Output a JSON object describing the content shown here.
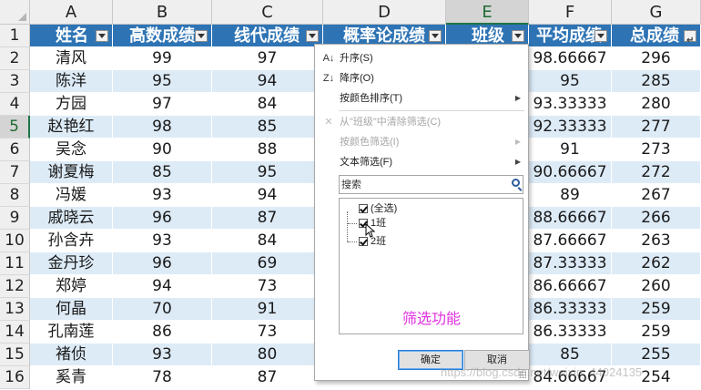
{
  "columns": [
    "A",
    "B",
    "C",
    "D",
    "E",
    "F",
    "G"
  ],
  "selected_column": "E",
  "selected_row": "5",
  "header_row_number": "1",
  "headers": [
    "姓名",
    "高数成绩",
    "线代成绩",
    "概率论成绩",
    "班级",
    "平均成绩",
    "总成绩"
  ],
  "rows": [
    {
      "num": "2",
      "name": "清风",
      "math": "99",
      "linear": "97",
      "avg": "98.66667",
      "total": "296"
    },
    {
      "num": "3",
      "name": "陈洋",
      "math": "95",
      "linear": "94",
      "avg": "95",
      "total": "285"
    },
    {
      "num": "4",
      "name": "方园",
      "math": "97",
      "linear": "84",
      "avg": "93.33333",
      "total": "280"
    },
    {
      "num": "5",
      "name": "赵艳红",
      "math": "98",
      "linear": "85",
      "avg": "92.33333",
      "total": "277"
    },
    {
      "num": "6",
      "name": "吴念",
      "math": "90",
      "linear": "88",
      "avg": "91",
      "total": "273"
    },
    {
      "num": "7",
      "name": "谢夏梅",
      "math": "85",
      "linear": "95",
      "avg": "90.66667",
      "total": "272"
    },
    {
      "num": "8",
      "name": "冯媛",
      "math": "93",
      "linear": "94",
      "avg": "89",
      "total": "267"
    },
    {
      "num": "9",
      "name": "戚晓云",
      "math": "96",
      "linear": "87",
      "avg": "88.66667",
      "total": "266"
    },
    {
      "num": "10",
      "name": "孙含卉",
      "math": "93",
      "linear": "84",
      "avg": "87.66667",
      "total": "263"
    },
    {
      "num": "11",
      "name": "金丹珍",
      "math": "96",
      "linear": "69",
      "avg": "87.33333",
      "total": "262"
    },
    {
      "num": "12",
      "name": "郑婷",
      "math": "94",
      "linear": "73",
      "avg": "86.66667",
      "total": "260"
    },
    {
      "num": "13",
      "name": "何晶",
      "math": "70",
      "linear": "91",
      "avg": "86.33333",
      "total": "259"
    },
    {
      "num": "14",
      "name": "孔南莲",
      "math": "86",
      "linear": "73",
      "avg": "86.33333",
      "total": "259"
    },
    {
      "num": "15",
      "name": "褚侦",
      "math": "93",
      "linear": "80",
      "avg": "85",
      "total": "255"
    },
    {
      "num": "16",
      "name": "奚青",
      "math": "78",
      "linear": "87",
      "avg": "84.66667",
      "total": "254"
    }
  ],
  "menu": {
    "sort_asc": "升序(S)",
    "sort_asc_icon": "sort-az",
    "sort_asc_glyph": "A↓",
    "sort_desc": "降序(O)",
    "sort_desc_icon": "sort-za",
    "sort_desc_glyph": "Z↓",
    "sort_by_color": "按颜色排序(T)",
    "clear_filter": "从\"班级\"中清除筛选(C)",
    "clear_filter_glyph": "✕",
    "filter_by_color": "按颜色筛选(I)",
    "text_filter": "文本筛选(F)",
    "search_placeholder": "搜索",
    "list": [
      "(全选)",
      "1班",
      "2班"
    ],
    "ok": "确定",
    "cancel": "取消"
  },
  "caption": "筛选功能",
  "watermark": "https://blog.csdn.net/weixin_44024135",
  "colors": {
    "header_bg": "#2e74b5",
    "band": "#ddebf7",
    "caption": "#e030e0",
    "accent": "#217346"
  }
}
